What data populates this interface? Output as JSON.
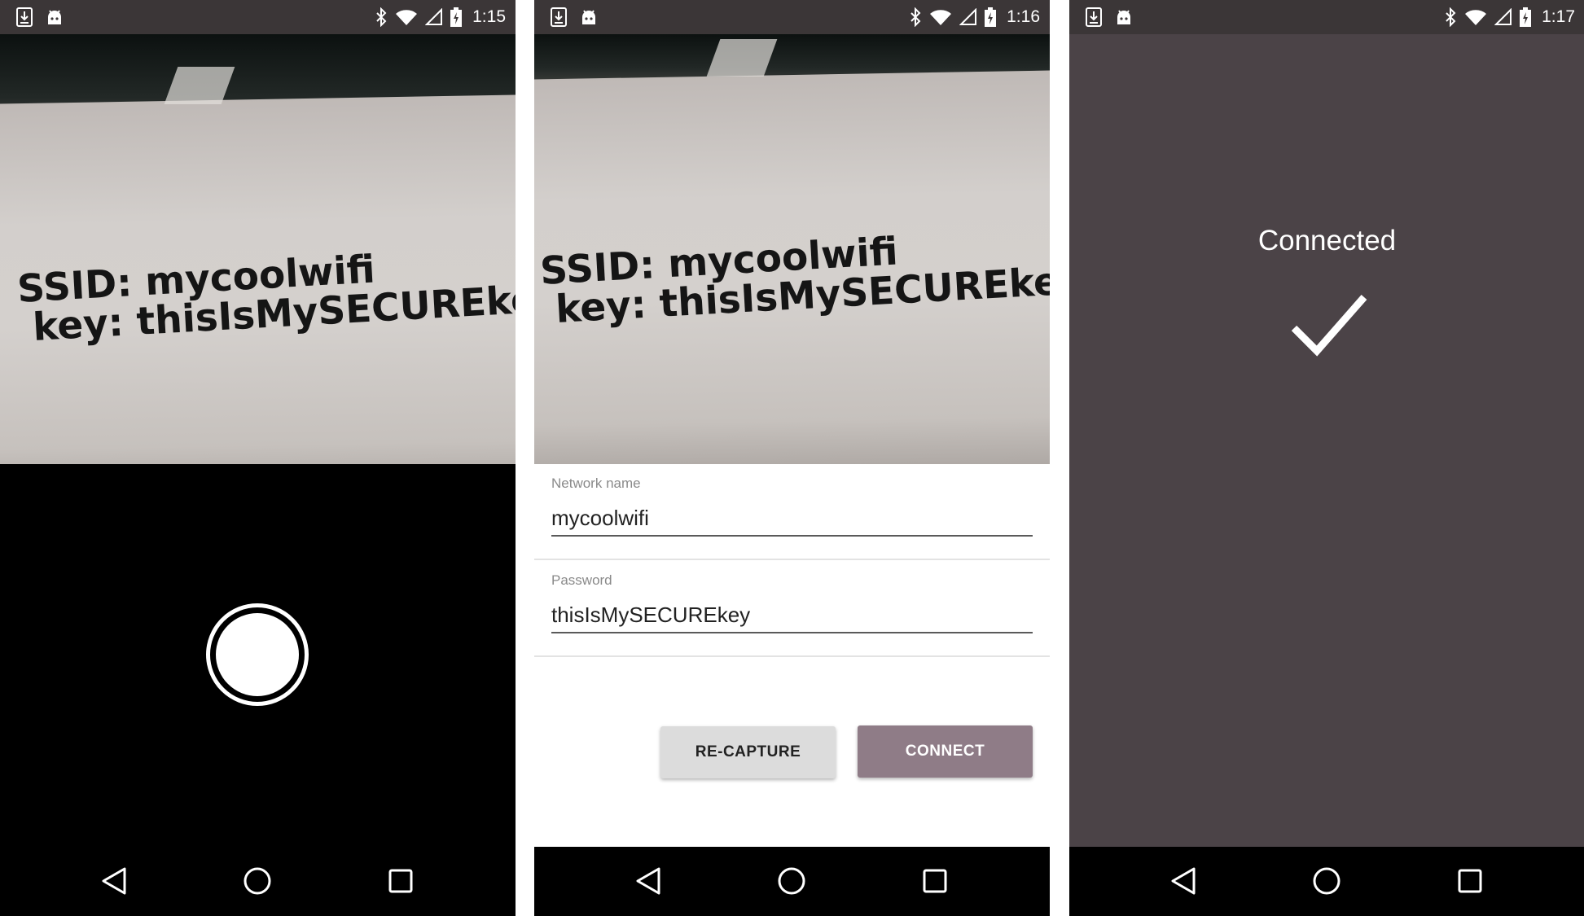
{
  "screens": [
    {
      "status_time": "1:15",
      "camera_text": {
        "line1": "SSID: mycoolwifi",
        "line2": "key: thisIsMySECUREkey"
      }
    },
    {
      "status_time": "1:16",
      "camera_text": {
        "line1": "SSID: mycoolwifi",
        "line2": "key: thisIsMySECUREkey"
      },
      "form": {
        "network_label": "Network name",
        "network_value": "mycoolwifi",
        "password_label": "Password",
        "password_value": "thisIsMySECUREkey",
        "recapture_label": "RE-CAPTURE",
        "connect_label": "CONNECT"
      }
    },
    {
      "status_time": "1:17",
      "connected_label": "Connected"
    }
  ],
  "status_icons": [
    "download-icon",
    "android-icon",
    "bluetooth-icon",
    "wifi-icon",
    "signal-icon",
    "battery-charging-icon"
  ],
  "nav_icons": [
    "back-icon",
    "home-icon",
    "recents-icon"
  ],
  "colors": {
    "status_bar": "#3b3637",
    "connect_button": "#8f7c87",
    "recapture_button": "#dcdcdc",
    "connected_background": "#4b4347"
  }
}
